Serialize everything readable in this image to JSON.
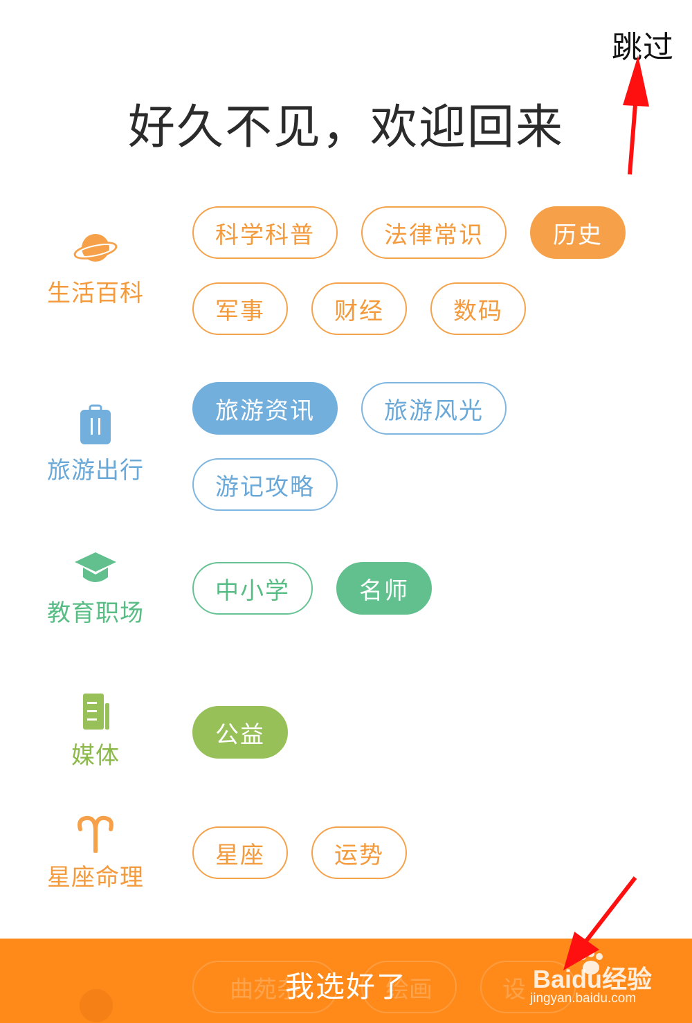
{
  "header": {
    "skip_label": "跳过",
    "title": "好久不见，欢迎回来"
  },
  "categories": [
    {
      "label": "生活百科",
      "icon": "planet-icon",
      "color": "#f39a3d",
      "tags": [
        {
          "label": "科学科普",
          "selected": false
        },
        {
          "label": "法律常识",
          "selected": false
        },
        {
          "label": "历史",
          "selected": true
        },
        {
          "label": "军事",
          "selected": false
        },
        {
          "label": "财经",
          "selected": false
        },
        {
          "label": "数码",
          "selected": false
        }
      ]
    },
    {
      "label": "旅游出行",
      "icon": "suitcase-icon",
      "color": "#6aa8d8",
      "tags": [
        {
          "label": "旅游资讯",
          "selected": true
        },
        {
          "label": "旅游风光",
          "selected": false
        },
        {
          "label": "游记攻略",
          "selected": false
        }
      ]
    },
    {
      "label": "教育职场",
      "icon": "graduation-cap-icon",
      "color": "#58bd85",
      "tags": [
        {
          "label": "中小学",
          "selected": false
        },
        {
          "label": "名师",
          "selected": true
        }
      ]
    },
    {
      "label": "媒体",
      "icon": "newspaper-icon",
      "color": "#8cba4a",
      "tags": [
        {
          "label": "公益",
          "selected": true
        }
      ]
    },
    {
      "label": "星座命理",
      "icon": "aries-icon",
      "color": "#f39a3d",
      "tags": [
        {
          "label": "星座",
          "selected": false
        },
        {
          "label": "运势",
          "selected": false
        }
      ]
    }
  ],
  "partially_hidden_tags": [
    "曲苑杂",
    "绘画",
    "设"
  ],
  "footer": {
    "confirm_label": "我选好了"
  },
  "watermark": {
    "brand": "Baidu经验",
    "url": "jingyan.baidu.com"
  },
  "colors": {
    "accent_orange": "#ff8a1a",
    "arrow_red": "#ff1010"
  }
}
